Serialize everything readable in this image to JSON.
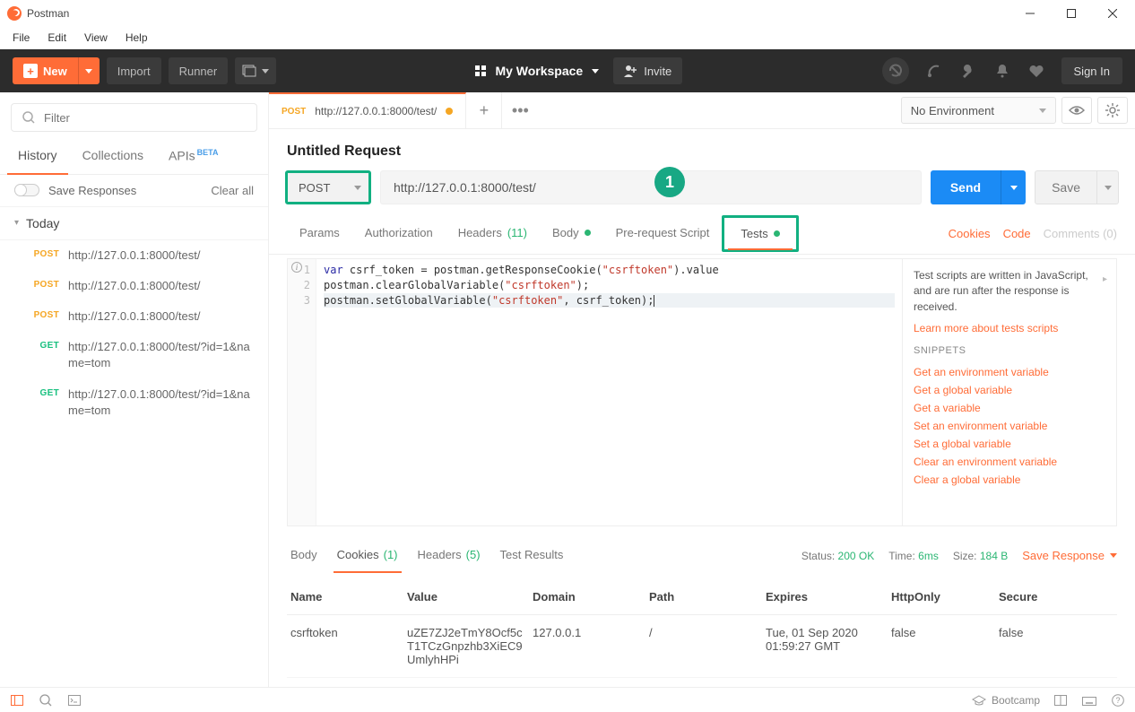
{
  "app": {
    "title": "Postman"
  },
  "menubar": [
    "File",
    "Edit",
    "View",
    "Help"
  ],
  "header": {
    "new_label": "New",
    "import_label": "Import",
    "runner_label": "Runner",
    "workspace": "My Workspace",
    "invite_label": "Invite",
    "signin_label": "Sign In"
  },
  "sidebar": {
    "filter_placeholder": "Filter",
    "tabs": {
      "history": "History",
      "collections": "Collections",
      "apis": "APIs",
      "apis_badge": "BETA"
    },
    "save_responses_label": "Save Responses",
    "clear_all": "Clear all",
    "section": "Today",
    "history": [
      {
        "method": "POST",
        "url": "http://127.0.0.1:8000/test/"
      },
      {
        "method": "POST",
        "url": "http://127.0.0.1:8000/test/"
      },
      {
        "method": "POST",
        "url": "http://127.0.0.1:8000/test/"
      },
      {
        "method": "GET",
        "url": "http://127.0.0.1:8000/test/?id=1&name=tom"
      },
      {
        "method": "GET",
        "url": "http://127.0.0.1:8000/test/?id=1&name=tom"
      }
    ]
  },
  "environment": {
    "selected": "No Environment"
  },
  "tab": {
    "method": "POST",
    "url": "http://127.0.0.1:8000/test/"
  },
  "request": {
    "title": "Untitled Request",
    "method": "POST",
    "url": "http://127.0.0.1:8000/test/",
    "send_label": "Send",
    "save_label": "Save",
    "sub_tabs": {
      "params": "Params",
      "auth": "Authorization",
      "headers": "Headers",
      "headers_count": "(11)",
      "body": "Body",
      "prereq": "Pre-request Script",
      "tests": "Tests"
    },
    "right_links": {
      "cookies": "Cookies",
      "code": "Code",
      "comments": "Comments (0)"
    },
    "annotation": "1"
  },
  "tests_code": {
    "lines": [
      [
        {
          "t": "var",
          "c": "kw"
        },
        {
          "t": " csrf_token = postman.getResponseCookie("
        },
        {
          "t": "\"csrftoken\"",
          "c": "str"
        },
        {
          "t": ").value"
        }
      ],
      [
        {
          "t": "postman.clearGlobalVariable("
        },
        {
          "t": "\"csrftoken\"",
          "c": "str"
        },
        {
          "t": ");"
        }
      ],
      [
        {
          "t": "postman.setGlobalVariable("
        },
        {
          "t": "\"csrftoken\"",
          "c": "str"
        },
        {
          "t": ", csrf_token);"
        }
      ]
    ]
  },
  "side_panel": {
    "desc": "Test scripts are written in JavaScript, and are run after the response is received.",
    "learn_more": "Learn more about tests scripts",
    "snippets_header": "SNIPPETS",
    "snippets": [
      "Get an environment variable",
      "Get a global variable",
      "Get a variable",
      "Set an environment variable",
      "Set a global variable",
      "Clear an environment variable",
      "Clear a global variable"
    ]
  },
  "response": {
    "tabs": {
      "body": "Body",
      "cookies": "Cookies",
      "cookies_count": "(1)",
      "headers": "Headers",
      "headers_count": "(5)",
      "test_results": "Test Results"
    },
    "status_label": "Status:",
    "status_value": "200 OK",
    "time_label": "Time:",
    "time_value": "6ms",
    "size_label": "Size:",
    "size_value": "184 B",
    "save_response": "Save Response",
    "cookies_table": {
      "headers": [
        "Name",
        "Value",
        "Domain",
        "Path",
        "Expires",
        "HttpOnly",
        "Secure"
      ],
      "rows": [
        {
          "name": "csrftoken",
          "value": "uZE7ZJ2eTmY8Ocf5cT1TCzGnpzhb3XiEC9UmlyhHPi",
          "domain": "127.0.0.1",
          "path": "/",
          "expires": "Tue, 01 Sep 2020 01:59:27 GMT",
          "httponly": "false",
          "secure": "false"
        }
      ]
    }
  },
  "statusbar": {
    "bootcamp": "Bootcamp"
  }
}
